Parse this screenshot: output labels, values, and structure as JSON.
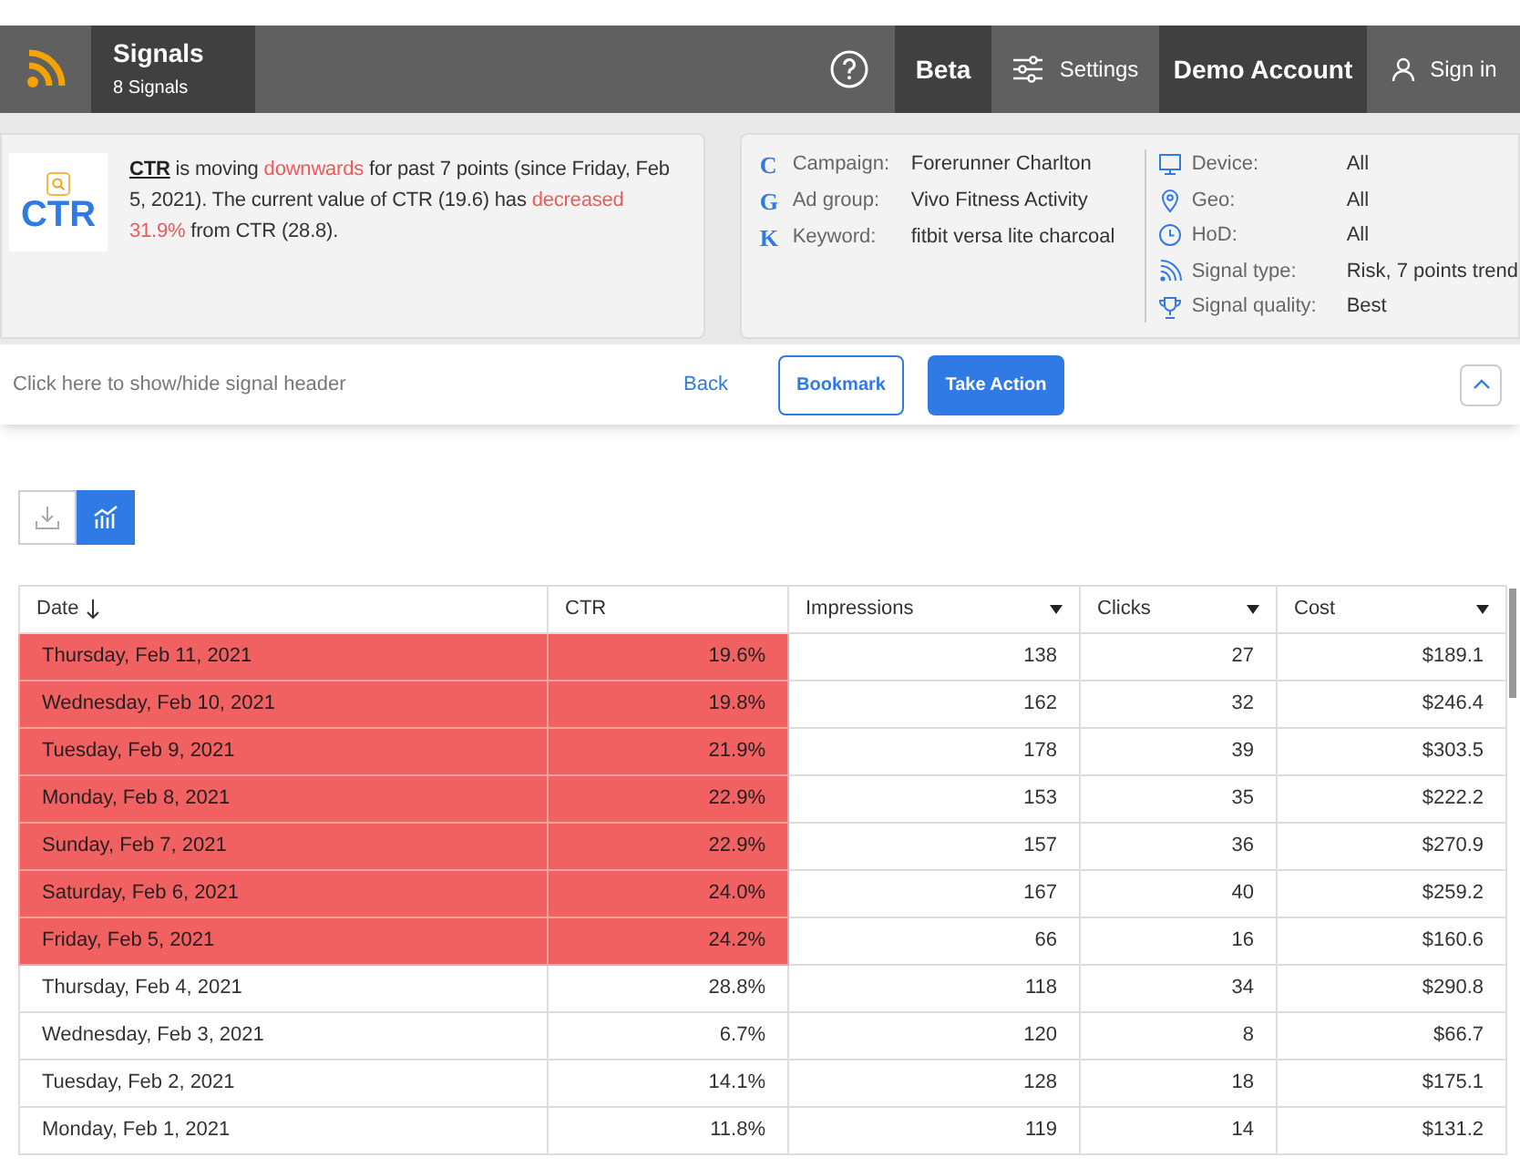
{
  "header": {
    "title": "Signals",
    "subtitle": "8 Signals",
    "beta": "Beta",
    "settings": "Settings",
    "account": "Demo Account",
    "sign_in": "Sign in"
  },
  "summary": {
    "logo_text": "CTR",
    "segments": [
      {
        "kind": "link",
        "text": "CTR"
      },
      {
        "kind": "plain",
        "text": " is moving "
      },
      {
        "kind": "alert",
        "text": "downwards"
      },
      {
        "kind": "plain",
        "text": " for past 7 points (since Friday, Feb 5, 2021). The current value of CTR (19.6) has "
      },
      {
        "kind": "alert",
        "text": "decreased 31.9%"
      },
      {
        "kind": "plain",
        "text": " from CTR (28.8)."
      }
    ]
  },
  "details_left": [
    {
      "icon": "C",
      "label": "Campaign:",
      "value": "Forerunner Charlton"
    },
    {
      "icon": "G",
      "label": "Ad group:",
      "value": "Vivo Fitness Activity"
    },
    {
      "icon": "K",
      "label": "Keyword:",
      "value": "fitbit versa lite charcoal"
    }
  ],
  "details_right": [
    {
      "kind": "device",
      "label": "Device:",
      "value": "All"
    },
    {
      "kind": "geo",
      "label": "Geo:",
      "value": "All"
    },
    {
      "kind": "clock",
      "label": "HoD:",
      "value": "All"
    },
    {
      "kind": "signal",
      "label": "Signal type:",
      "value": "Risk, 7 points trend"
    },
    {
      "kind": "trophy",
      "label": "Signal quality:",
      "value": "Best"
    }
  ],
  "footer": {
    "toggle_hint": "Click here to show/hide signal header",
    "back": "Back",
    "bookmark": "Bookmark",
    "take_action": "Take Action"
  },
  "view_buttons": [
    {
      "kind": "download",
      "selected": false
    },
    {
      "kind": "chart",
      "selected": true
    }
  ],
  "table": {
    "columns": [
      {
        "label": "Date",
        "sorted": true,
        "menu": false
      },
      {
        "label": "CTR",
        "sorted": false,
        "menu": false
      },
      {
        "label": "Impressions",
        "sorted": false,
        "menu": true
      },
      {
        "label": "Clicks",
        "sorted": false,
        "menu": true
      },
      {
        "label": "Cost",
        "sorted": false,
        "menu": true
      }
    ],
    "rows": [
      {
        "highlighted": true,
        "cells": [
          "Thursday, Feb 11, 2021",
          "19.6%",
          "138",
          "27",
          "$189.1"
        ]
      },
      {
        "highlighted": true,
        "cells": [
          "Wednesday, Feb 10, 2021",
          "19.8%",
          "162",
          "32",
          "$246.4"
        ]
      },
      {
        "highlighted": true,
        "cells": [
          "Tuesday, Feb 9, 2021",
          "21.9%",
          "178",
          "39",
          "$303.5"
        ]
      },
      {
        "highlighted": true,
        "cells": [
          "Monday, Feb 8, 2021",
          "22.9%",
          "153",
          "35",
          "$222.2"
        ]
      },
      {
        "highlighted": true,
        "cells": [
          "Sunday, Feb 7, 2021",
          "22.9%",
          "157",
          "36",
          "$270.9"
        ]
      },
      {
        "highlighted": true,
        "cells": [
          "Saturday, Feb 6, 2021",
          "24.0%",
          "167",
          "40",
          "$259.2"
        ]
      },
      {
        "highlighted": true,
        "cells": [
          "Friday, Feb 5, 2021",
          "24.2%",
          "66",
          "16",
          "$160.6"
        ]
      },
      {
        "highlighted": false,
        "cells": [
          "Thursday, Feb 4, 2021",
          "28.8%",
          "118",
          "34",
          "$290.8"
        ]
      },
      {
        "highlighted": false,
        "cells": [
          "Wednesday, Feb 3, 2021",
          "6.7%",
          "120",
          "8",
          "$66.7"
        ]
      },
      {
        "highlighted": false,
        "cells": [
          "Tuesday, Feb 2, 2021",
          "14.1%",
          "128",
          "18",
          "$175.1"
        ]
      },
      {
        "highlighted": false,
        "cells": [
          "Monday, Feb 1, 2021",
          "11.8%",
          "119",
          "14",
          "$131.2"
        ]
      }
    ]
  }
}
